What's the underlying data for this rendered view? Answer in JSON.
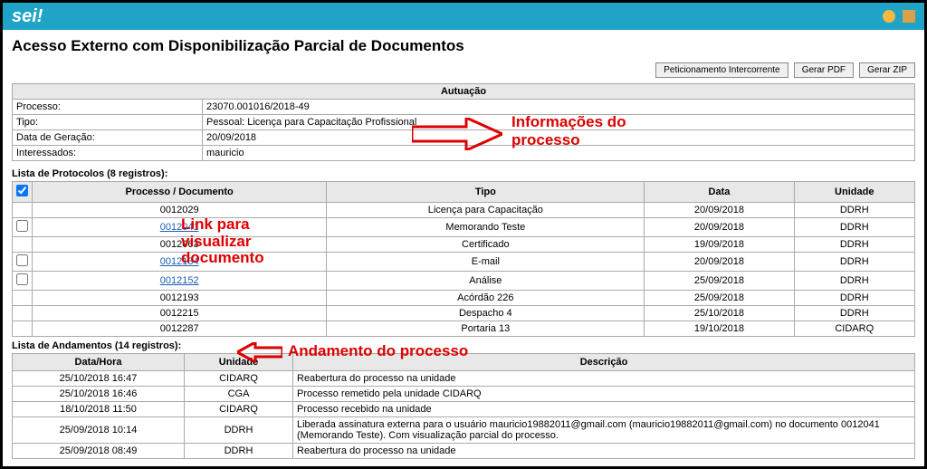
{
  "header": {
    "logo": "sei!"
  },
  "page_title": "Acesso Externo com Disponibilização Parcial de Documentos",
  "buttons": {
    "peticionamento": "Peticionamento Intercorrente",
    "gerar_pdf": "Gerar PDF",
    "gerar_zip": "Gerar ZIP"
  },
  "autuacao": {
    "section_title": "Autuação",
    "labels": {
      "processo": "Processo:",
      "tipo": "Tipo:",
      "data_geracao": "Data de Geração:",
      "interessados": "Interessados:"
    },
    "processo": "23070.001016/2018-49",
    "tipo": "Pessoal: Licença para Capacitação Profissional",
    "data_geracao": "20/09/2018",
    "interessados": "mauricio"
  },
  "protocolos": {
    "title": "Lista de Protocolos (8 registros):",
    "headers": {
      "doc": "Processo / Documento",
      "tipo": "Tipo",
      "data": "Data",
      "unidade": "Unidade"
    },
    "rows": [
      {
        "checkbox": false,
        "doc": "0012029",
        "link": false,
        "tipo": "Licença para Capacitação",
        "data": "20/09/2018",
        "unidade": "DDRH"
      },
      {
        "checkbox": true,
        "doc": "0012041",
        "link": true,
        "tipo": "Memorando Teste",
        "data": "20/09/2018",
        "unidade": "DDRH"
      },
      {
        "checkbox": false,
        "doc": "0012063",
        "link": false,
        "tipo": "Certificado",
        "data": "19/09/2018",
        "unidade": "DDRH"
      },
      {
        "checkbox": true,
        "doc": "0012134",
        "link": true,
        "tipo": "E-mail",
        "data": "20/09/2018",
        "unidade": "DDRH"
      },
      {
        "checkbox": true,
        "doc": "0012152",
        "link": true,
        "tipo": "Análise",
        "data": "25/09/2018",
        "unidade": "DDRH"
      },
      {
        "checkbox": false,
        "doc": "0012193",
        "link": false,
        "tipo": "Acórdão 226",
        "data": "25/09/2018",
        "unidade": "DDRH"
      },
      {
        "checkbox": false,
        "doc": "0012215",
        "link": false,
        "tipo": "Despacho 4",
        "data": "25/10/2018",
        "unidade": "DDRH"
      },
      {
        "checkbox": false,
        "doc": "0012287",
        "link": false,
        "tipo": "Portaria 13",
        "data": "19/10/2018",
        "unidade": "CIDARQ"
      }
    ]
  },
  "andamentos": {
    "title": "Lista de Andamentos (14 registros):",
    "headers": {
      "datahora": "Data/Hora",
      "unidade": "Unidade",
      "descricao": "Descrição"
    },
    "rows": [
      {
        "datahora": "25/10/2018 16:47",
        "unidade": "CIDARQ",
        "descricao": "Reabertura do processo na unidade"
      },
      {
        "datahora": "25/10/2018 16:46",
        "unidade": "CGA",
        "descricao": "Processo remetido pela unidade CIDARQ"
      },
      {
        "datahora": "18/10/2018 11:50",
        "unidade": "CIDARQ",
        "descricao": "Processo recebido na unidade"
      },
      {
        "datahora": "25/09/2018 10:14",
        "unidade": "DDRH",
        "descricao": "Liberada assinatura externa para o usuário mauricio19882011@gmail.com (mauricio19882011@gmail.com) no documento 0012041 (Memorando Teste). Com visualização parcial do processo."
      },
      {
        "datahora": "25/09/2018 08:49",
        "unidade": "DDRH",
        "descricao": "Reabertura do processo na unidade"
      }
    ]
  },
  "annotations": {
    "info_processo": "Informações do\nprocesso",
    "link_doc": "Link para\nvisualizar\ndocumento",
    "andamento": "Andamento do processo"
  }
}
